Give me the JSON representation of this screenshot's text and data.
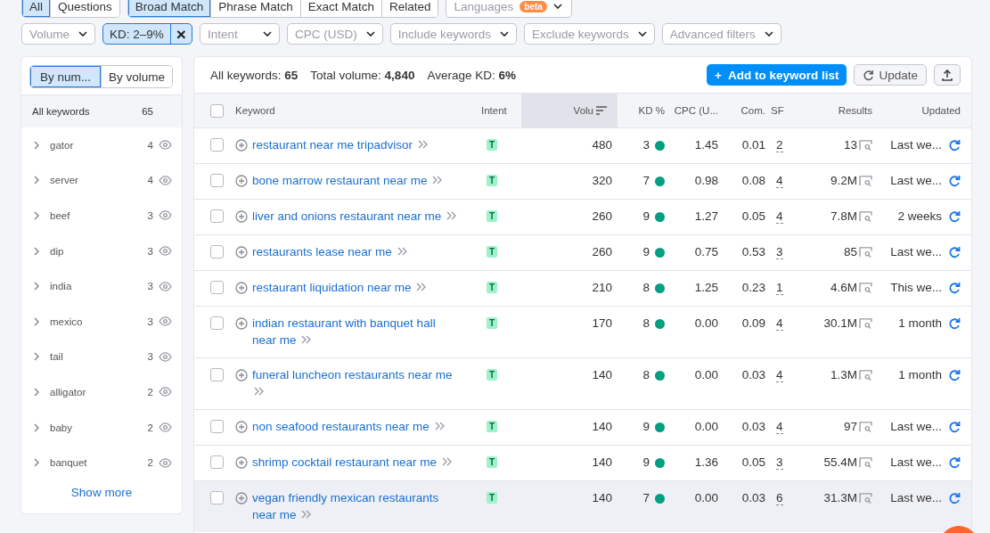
{
  "type_groups": [
    {
      "tabs": [
        {
          "label": "All",
          "selected": true
        },
        {
          "label": "Questions",
          "selected": false
        }
      ]
    },
    {
      "tabs": [
        {
          "label": "Broad Match",
          "selected": true
        },
        {
          "label": "Phrase Match",
          "selected": false
        },
        {
          "label": "Exact Match",
          "selected": false
        },
        {
          "label": "Related",
          "selected": false
        }
      ]
    }
  ],
  "languages": {
    "label": "Languages",
    "badge": "beta"
  },
  "filters": [
    {
      "kind": "dropdown",
      "label": "Volume"
    },
    {
      "kind": "chip",
      "label": "KD: 2–9%",
      "close": "×"
    },
    {
      "kind": "dropdown",
      "label": "Intent"
    },
    {
      "kind": "dropdown",
      "label": "CPC (USD)"
    },
    {
      "kind": "dropdown",
      "label": "Include keywords"
    },
    {
      "kind": "dropdown",
      "label": "Exclude keywords"
    },
    {
      "kind": "dropdown",
      "label": "Advanced filters"
    }
  ],
  "sidebar": {
    "sort_tabs": [
      {
        "label": "By num...",
        "selected": true
      },
      {
        "label": "By volume",
        "selected": false
      }
    ],
    "all": {
      "label": "All keywords",
      "count": "65"
    },
    "groups": [
      {
        "label": "gator",
        "count": "4"
      },
      {
        "label": "server",
        "count": "4"
      },
      {
        "label": "beef",
        "count": "3"
      },
      {
        "label": "dip",
        "count": "3"
      },
      {
        "label": "india",
        "count": "3"
      },
      {
        "label": "mexico",
        "count": "3"
      },
      {
        "label": "tail",
        "count": "3"
      },
      {
        "label": "alligator",
        "count": "2"
      },
      {
        "label": "baby",
        "count": "2"
      },
      {
        "label": "banquet",
        "count": "2"
      }
    ],
    "show_more": "Show more"
  },
  "summary": [
    "All keywords: **65**",
    "Total volume: **4,840**",
    "Average KD: **6%**"
  ],
  "actions": {
    "add": {
      "icon": "+",
      "label": "Add to keyword list"
    },
    "update": "Update"
  },
  "table": {
    "select_all_checked": false,
    "columns": [
      {
        "label": "Keyword",
        "sorted": false
      },
      {
        "label": "Intent",
        "sorted": false
      },
      {
        "label": "Volu",
        "sorted": true
      },
      {
        "label": "KD %",
        "sorted": false
      },
      {
        "label": "CPC (U...",
        "sorted": false
      },
      {
        "label": "Com.",
        "sorted": false
      },
      {
        "label": "SF",
        "sorted": false
      },
      {
        "label": "Results",
        "sorted": false
      },
      {
        "label": "Updated",
        "sorted": false
      }
    ],
    "rows": [
      {
        "keyword": "restaurant near me tripadvisor",
        "intent": "T",
        "volume": "480",
        "kd": "3",
        "cpc": "1.45",
        "com": "0.01",
        "sf": "2",
        "results": "13",
        "updated": "Last we...",
        "highlighted": false
      },
      {
        "keyword": "bone marrow restaurant near me",
        "intent": "T",
        "volume": "320",
        "kd": "7",
        "cpc": "0.98",
        "com": "0.08",
        "sf": "4",
        "results": "9.2M",
        "updated": "Last we...",
        "highlighted": false
      },
      {
        "keyword": "liver and onions restaurant near me",
        "intent": "T",
        "volume": "260",
        "kd": "9",
        "cpc": "1.27",
        "com": "0.05",
        "sf": "4",
        "results": "7.8M",
        "updated": "2 weeks",
        "highlighted": false
      },
      {
        "keyword": "restaurants lease near me",
        "intent": "T",
        "volume": "260",
        "kd": "9",
        "cpc": "0.75",
        "com": "0.53",
        "sf": "3",
        "results": "85",
        "updated": "Last we...",
        "highlighted": false
      },
      {
        "keyword": "restaurant liquidation near me",
        "intent": "T",
        "volume": "210",
        "kd": "8",
        "cpc": "1.25",
        "com": "0.23",
        "sf": "1",
        "results": "4.6M",
        "updated": "This we...",
        "highlighted": false
      },
      {
        "keyword": "indian restaurant with banquet hall near me",
        "intent": "T",
        "volume": "170",
        "kd": "8",
        "cpc": "0.00",
        "com": "0.09",
        "sf": "4",
        "results": "30.1M",
        "updated": "1 month",
        "highlighted": false
      },
      {
        "keyword": "funeral luncheon restaurants near me",
        "intent": "T",
        "volume": "140",
        "kd": "8",
        "cpc": "0.00",
        "com": "0.03",
        "sf": "4",
        "results": "1.3M",
        "updated": "1 month",
        "highlighted": false
      },
      {
        "keyword": "non seafood restaurants near me",
        "intent": "T",
        "volume": "140",
        "kd": "9",
        "cpc": "0.00",
        "com": "0.03",
        "sf": "4",
        "results": "97",
        "updated": "Last we...",
        "highlighted": false
      },
      {
        "keyword": "shrimp cocktail restaurant near me",
        "intent": "T",
        "volume": "140",
        "kd": "9",
        "cpc": "1.36",
        "com": "0.05",
        "sf": "3",
        "results": "55.4M",
        "updated": "Last we...",
        "highlighted": false
      },
      {
        "keyword": "vegan friendly mexican restaurants near me",
        "intent": "T",
        "volume": "140",
        "kd": "7",
        "cpc": "0.00",
        "com": "0.03",
        "sf": "6",
        "results": "31.3M",
        "updated": "Last we...",
        "highlighted": true
      }
    ]
  }
}
